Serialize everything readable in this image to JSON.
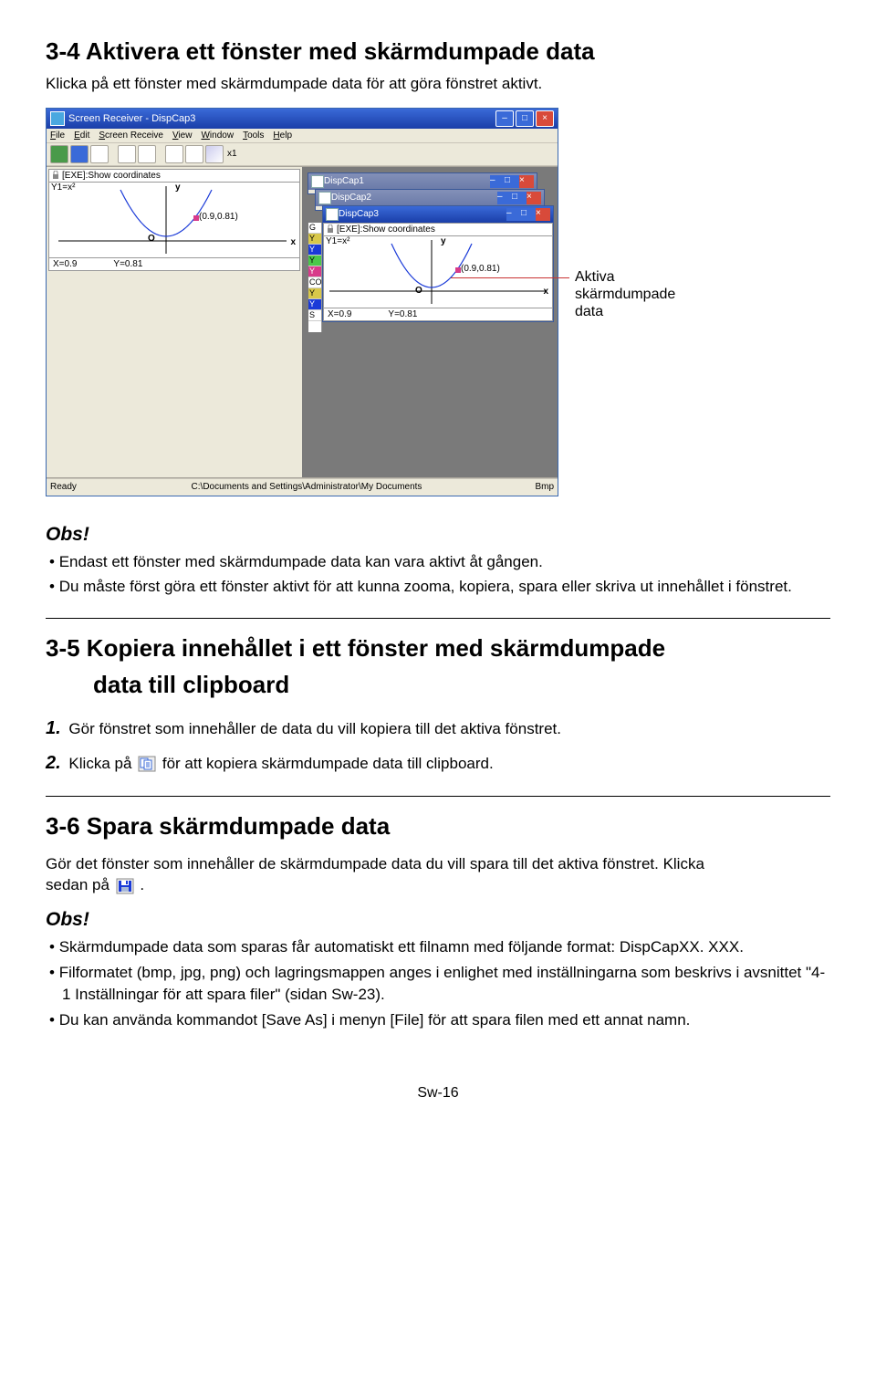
{
  "section34": {
    "title": "3-4 Aktivera ett fönster med skärmdumpade data",
    "intro": "Klicka på ett fönster med skärmdumpade data för att göra fönstret aktivt."
  },
  "callout": {
    "line1": "Aktiva skärmdumpade",
    "line2": "data"
  },
  "appWindow": {
    "title": "Screen Receiver - DispCap3",
    "menus": [
      "File",
      "Edit",
      "Screen Receive",
      "View",
      "Window",
      "Tools",
      "Help"
    ],
    "zoomLabel": "x1",
    "calcHead": "[EXE]:Show coordinates",
    "y1": "Y1=x²",
    "origin": "O",
    "point": "(0.9,0.81)",
    "xVal": "X=0.9",
    "yVal": "Y=0.81",
    "status": {
      "ready": "Ready",
      "path": "C:\\Documents and Settings\\Administrator\\My Documents",
      "fmt": "Bmp"
    },
    "children": {
      "c1": "DispCap1",
      "c2": "DispCap2",
      "c3": "DispCap3",
      "sidebarLetters": [
        "G",
        "Y",
        "Y",
        "Y",
        "Y",
        "CO",
        "Y",
        "Y",
        "S"
      ]
    }
  },
  "note34": {
    "head": "Obs!",
    "b1": "Endast ett fönster med skärmdumpade data kan vara aktivt åt gången.",
    "b2": "Du måste först göra ett fönster aktivt för att kunna zooma, kopiera, spara eller skriva ut innehållet i fönstret."
  },
  "section35": {
    "titleA": "3-5 Kopiera innehållet i ett fönster med skärmdumpade",
    "titleB": "data till clipboard",
    "step1": "Gör fönstret som innehåller de data du vill kopiera till det aktiva fönstret.",
    "step2a": "Klicka på ",
    "step2b": " för att kopiera skärmdumpade data till clipboard.",
    "step1num": "1.",
    "step2num": "2."
  },
  "section36": {
    "title": "3-6 Spara skärmdumpade data",
    "introA": "Gör det fönster som innehåller de skärmdumpade data du vill spara till det aktiva fönstret. Klicka",
    "introB": "sedan på ",
    "introC": "."
  },
  "note36": {
    "head": "Obs!",
    "b1": "Skärmdumpade data som sparas får automatiskt ett filnamn med följande format: DispCapXX. XXX.",
    "b2": "Filformatet (bmp, jpg, png) och lagringsmappen anges i enlighet med inställningarna som beskrivs i avsnittet \"4-1 Inställningar för att spara filer\" (sidan Sw-23).",
    "b3": "Du kan använda kommandot [Save As] i menyn [File] för att spara filen med ett annat namn."
  },
  "pageFoot": "Sw-16"
}
